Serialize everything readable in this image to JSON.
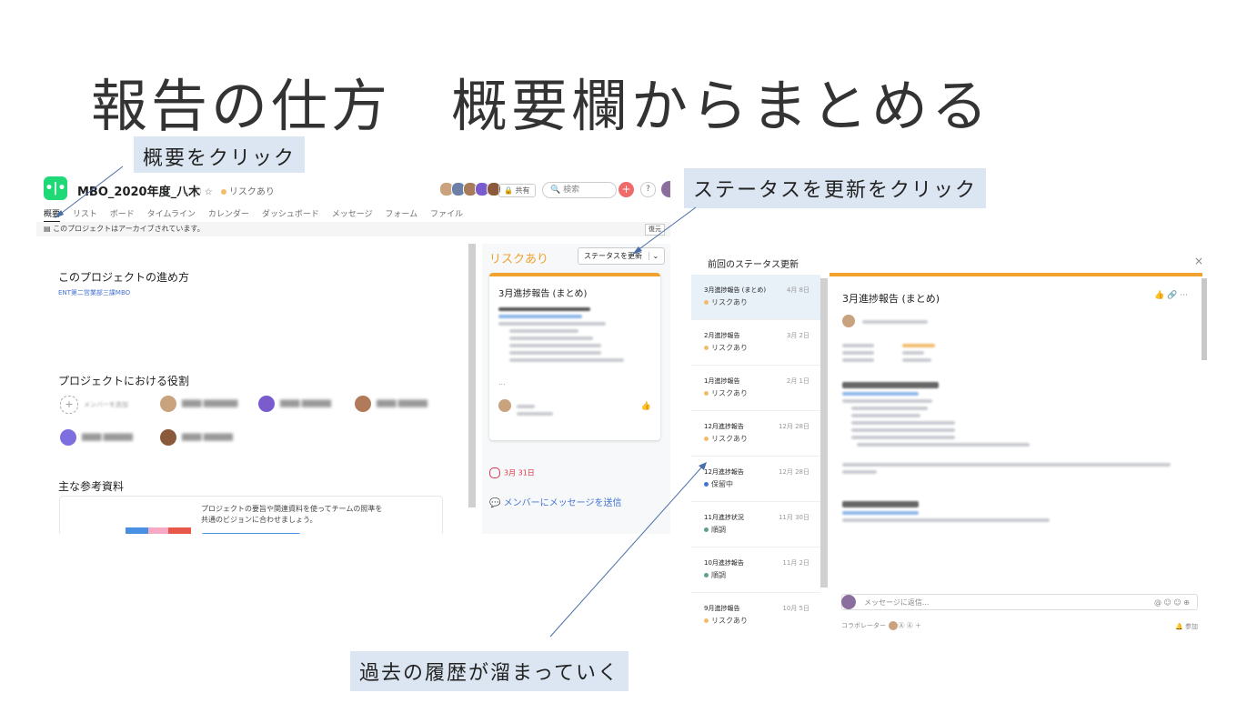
{
  "slide": {
    "title": "報告の仕方　概要欄からまとめる",
    "callout_overview": "概要をクリック",
    "callout_status": "ステータスを更新をクリック",
    "callout_history": "過去の履歴が溜まっていく"
  },
  "project": {
    "logo_text": "•|•",
    "name": "MBO_2020年度_八木",
    "meta": "⌄  ⓘ  ☆",
    "risk_label": "リスクあり",
    "share_label": "共有",
    "search_placeholder": "検索",
    "plus": "+",
    "help": "?",
    "tabs": [
      "概要",
      "リスト",
      "ボード",
      "タイムライン",
      "カレンダー",
      "ダッシュボード",
      "メッセージ",
      "フォーム",
      "ファイル"
    ],
    "archive_notice": "このプロジェクトはアーカイブされています。",
    "restore_label": "復元",
    "how_to_heading": "このプロジェクトの進め方",
    "team_label": "ENT第二営業部三課MBO",
    "roles_heading": "プロジェクトにおける役割",
    "add_member": "メンバーを追加",
    "references_heading": "主な参考資料",
    "references_text_1": "プロジェクトの要旨や関連資料を使ってチームの照準を",
    "references_text_2": "共通のビジョンに合わせましょう。"
  },
  "status_panel": {
    "risk_title": "リスクあり",
    "update_button": "ステータスを更新",
    "dropdown": "⌄",
    "card_title": "3月進捗報告 (まとめ)",
    "card_more": "...",
    "due_date": "3月 31日",
    "send_message": "メンバーにメッセージを送信"
  },
  "history": {
    "header": "前回のステータス更新",
    "close": "×",
    "items": [
      {
        "name": "3月進捗報告 (まとめ)",
        "date": "4月 8日",
        "status": "リスクあり",
        "color": "#f1bd6c"
      },
      {
        "name": "2月進捗報告",
        "date": "3月 2日",
        "status": "リスクあり",
        "color": "#f1bd6c"
      },
      {
        "name": "1月進捗報告",
        "date": "2月 1日",
        "status": "リスクあり",
        "color": "#f1bd6c"
      },
      {
        "name": "12月進捗報告",
        "date": "12月 28日",
        "status": "リスクあり",
        "color": "#f1bd6c"
      },
      {
        "name": "12月進捗報告",
        "date": "12月 28日",
        "status": "保留中",
        "color": "#4573d2"
      },
      {
        "name": "11月進捗状況",
        "date": "11月 30日",
        "status": "順調",
        "color": "#5da283"
      },
      {
        "name": "10月進捗報告",
        "date": "11月 2日",
        "status": "順調",
        "color": "#5da283"
      },
      {
        "name": "9月進捗報告",
        "date": "10月 5日",
        "status": "リスクあり",
        "color": "#f1bd6c"
      }
    ],
    "detail_title": "3月進捗報告 (まとめ)",
    "detail_icons": "👍  🔗  ···",
    "composer_placeholder": "メッセージに返信...",
    "composer_icons": "@  ☺  ☺  ⊕",
    "collaborators_label": "コラボレーター",
    "join_label": "参加"
  },
  "colors": {
    "accent": "#1fd876",
    "risk": "#f1a12e",
    "callout_bg": "#dce6f2"
  }
}
